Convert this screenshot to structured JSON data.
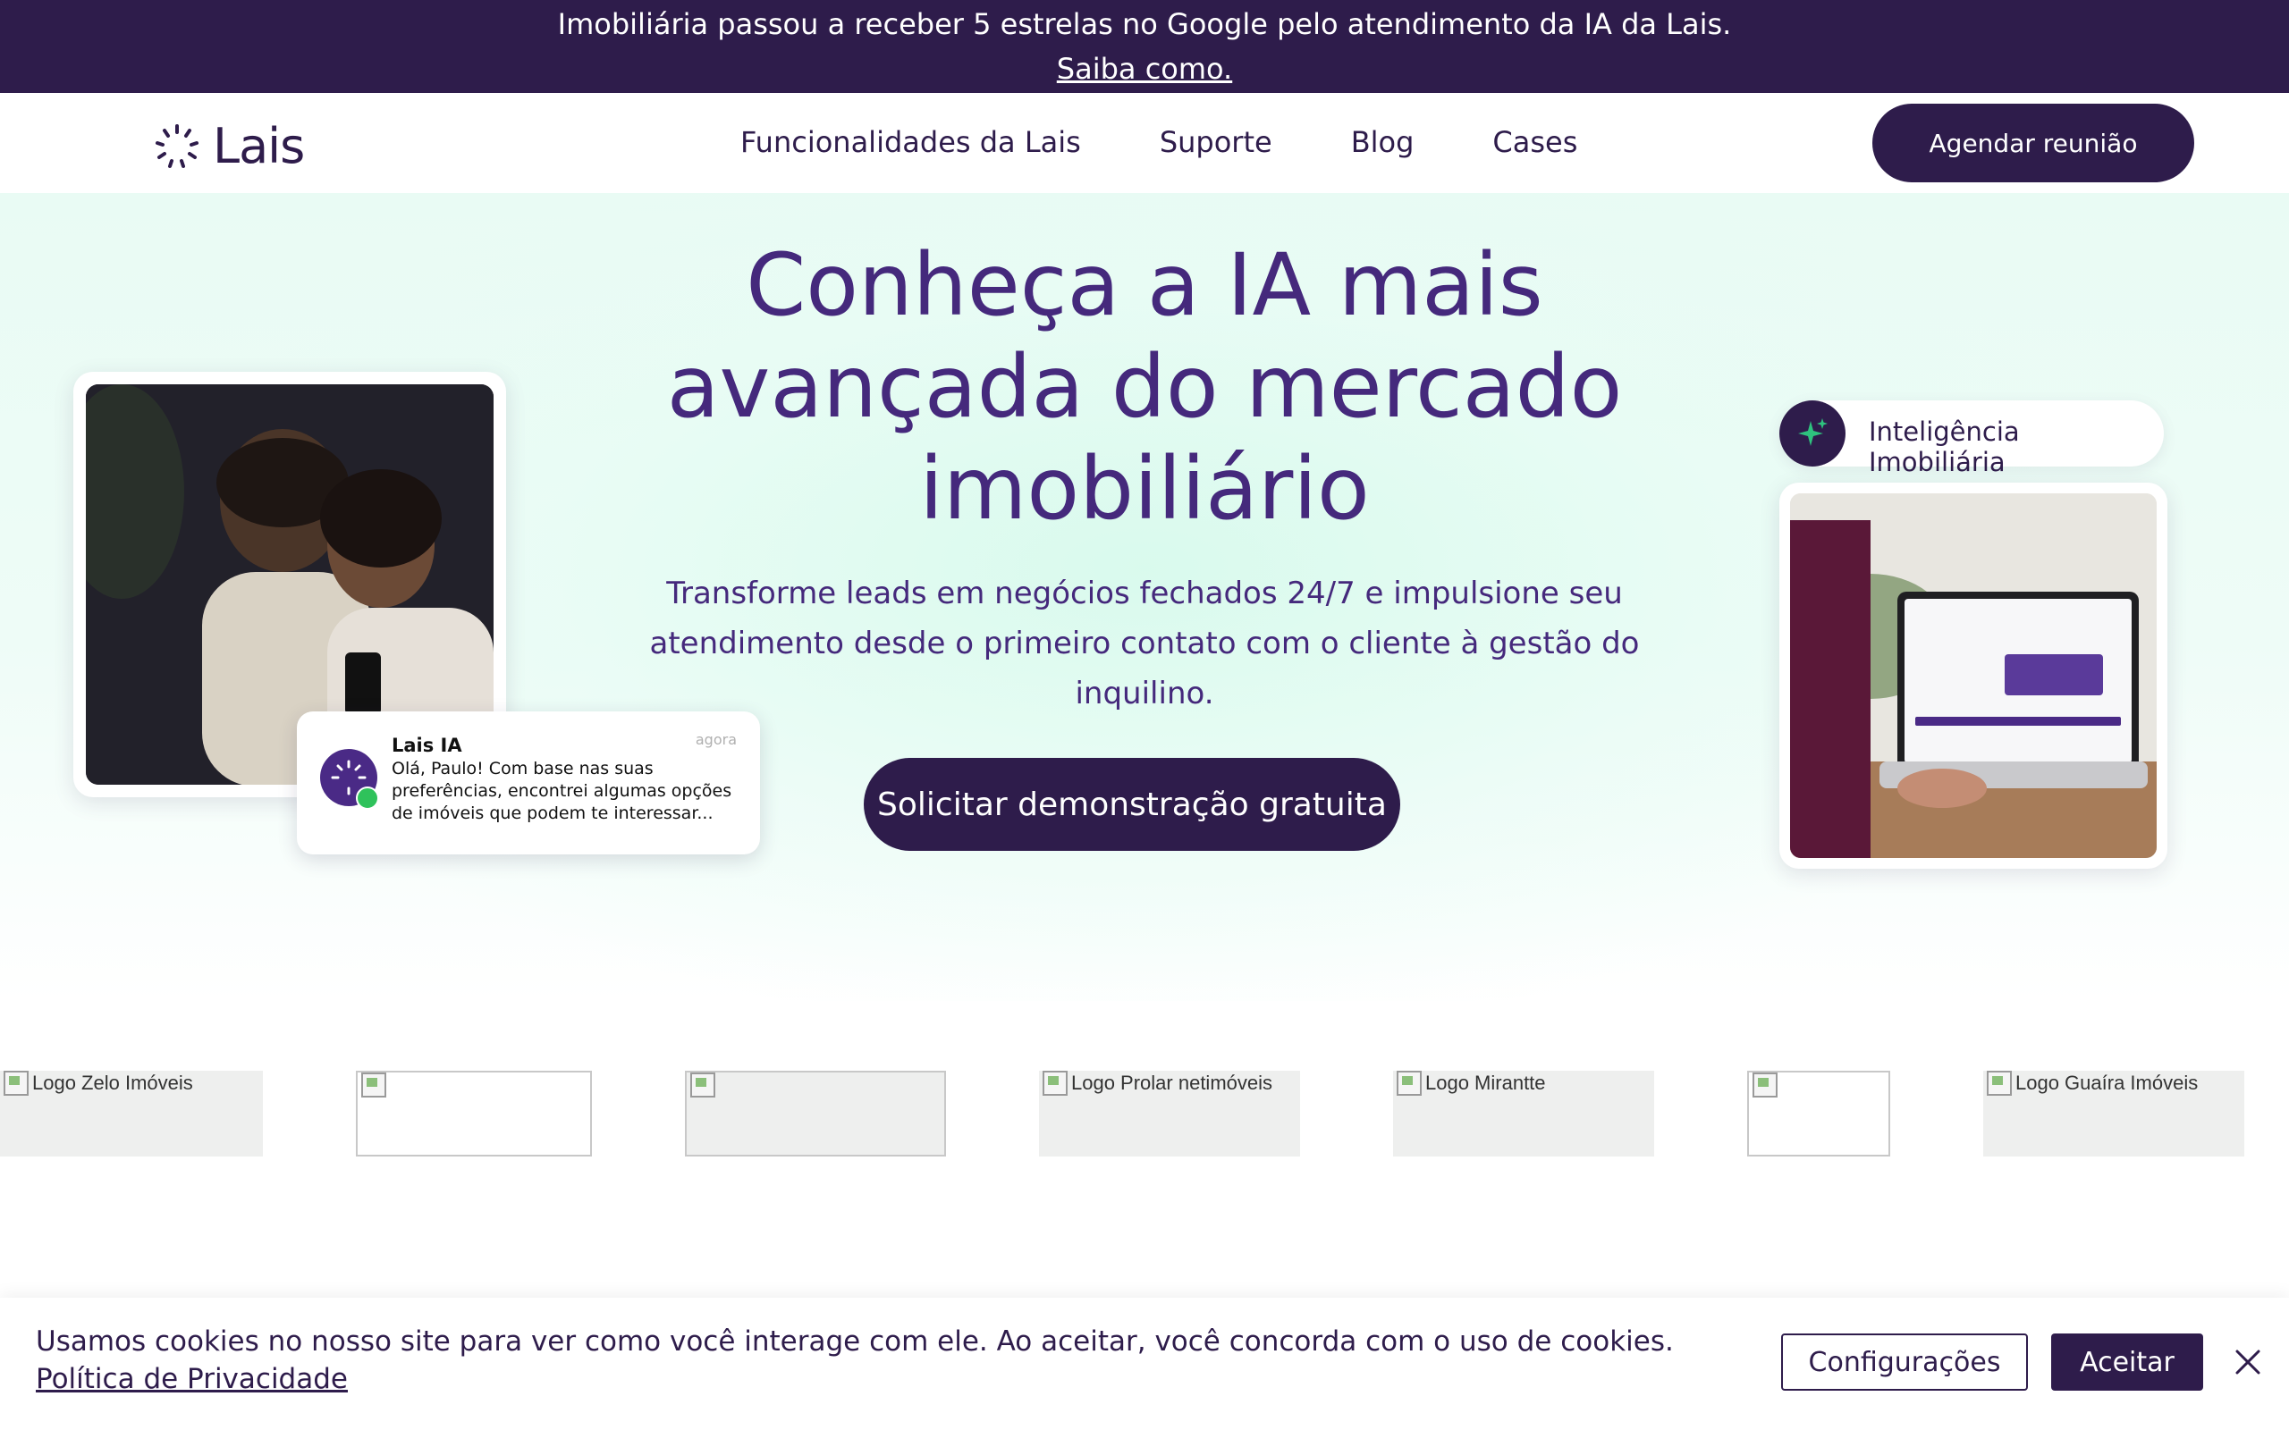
{
  "announcement": {
    "text": "Imobiliária passou a receber 5 estrelas no Google pelo atendimento da IA da Lais.",
    "link": "Saiba como."
  },
  "header": {
    "logo_text": "Lais",
    "nav": [
      "Funcionalidades da Lais",
      "Suporte",
      "Blog",
      "Cases"
    ],
    "cta": "Agendar reunião"
  },
  "hero": {
    "title": "Conheça a IA mais avançada do mercado imobiliário",
    "subtitle": "Transforme leads em negócios fechados 24/7 e impulsione seu atendimento desde o primeiro contato com o cliente à gestão do inquilino.",
    "cta": "Solicitar demonstração gratuita"
  },
  "notification": {
    "name": "Lais IA",
    "time": "agora",
    "message": "Olá, Paulo! Com base nas suas preferências, encontrei algumas opções de imóveis que podem te interessar..."
  },
  "badge": {
    "label": "Inteligência Imobiliária"
  },
  "logos": [
    {
      "alt": "Logo Zelo Imóveis"
    },
    {
      "alt": ""
    },
    {
      "alt": ""
    },
    {
      "alt": "Logo Prolar netimóveis"
    },
    {
      "alt": "Logo Mirantte"
    },
    {
      "alt": ""
    },
    {
      "alt": "Logo Guaíra Imóveis"
    }
  ],
  "cookie": {
    "text": "Usamos cookies no nosso site para ver como você interage com ele. Ao aceitar, você concorda com o uso de cookies.",
    "link": "Política de Privacidade",
    "settings": "Configurações",
    "accept": "Aceitar"
  },
  "colors": {
    "brand": "#2e1c4b",
    "heading": "#45297c",
    "hero_bg": "#e9fbf4",
    "accent_green": "#2ec27e"
  }
}
